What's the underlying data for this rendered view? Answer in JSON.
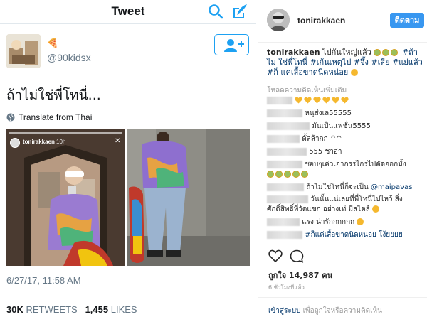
{
  "tweet": {
    "header_title": "Tweet",
    "badge": "🍕",
    "handle": "@90kidsx",
    "text": "ถ้าไม่ใช่พี่โทนี่...",
    "translate": "Translate from Thai",
    "story": {
      "user": "tonirakkaen",
      "time": "10h"
    },
    "date": "6/27/17, 11:58 AM",
    "retweets_count": "30K",
    "retweets_label": "RETWEETS",
    "likes_count": "1,455",
    "likes_label": "LIKES"
  },
  "instagram": {
    "username": "tonirakkaen",
    "follow_label": "ติดตาม",
    "caption_user": "tonirakkaen",
    "caption_text": "ไปกันใหญ่แล้ว",
    "caption_tags_line1": "#ถ้าไม่",
    "caption_tags_line2": "ใช่พี่โทนี่ #เก้นเหตุไป #จึ้ง #เสีย #แย่แล้ว #ก็",
    "caption_tags_line3": "แค่เสื้อขาดนิดหน่อย",
    "load_more": "โหลดความคิดเห็นเพิ่มเติม",
    "comments": [
      {
        "text": ""
      },
      {
        "text": "หนูส่งเล55555"
      },
      {
        "text": "มันเป็นแฟชั่น5555"
      },
      {
        "text": "ดั้ลล้ากก ^^"
      },
      {
        "text": "555 ชาอ่า"
      },
      {
        "text": "ชอบๆเค่วเอากรรไกรไปตัดออกมั้ง"
      },
      {
        "text": ""
      },
      {
        "text": "ถ้าไม่ใช่โทนี่ก็จะเป็น",
        "mention": "@maipavas"
      },
      {
        "text": "วันนั้นแน่เลยที่พี่โทนี่ไปไหว้ สิ่ง"
      },
      {
        "text": "ศักดิ์สิทธิ์ที่วัดแขก อย่างเท่ มีสไตล์"
      },
      {
        "text": "แรง น่ารักกกกกก"
      },
      {
        "text": "#ก็แค่เสื้อขาดนิดหน่อย โง้ยยยย"
      }
    ],
    "likes_prefix": "ถูกใจ",
    "likes_count": "14,987",
    "likes_suffix": "คน",
    "time": "6 ชั่วโมงที่แล้ว",
    "login_link": "เข้าสู่ระบบ",
    "login_text": "เพื่อถูกใจหรือความคิดเห็น"
  }
}
